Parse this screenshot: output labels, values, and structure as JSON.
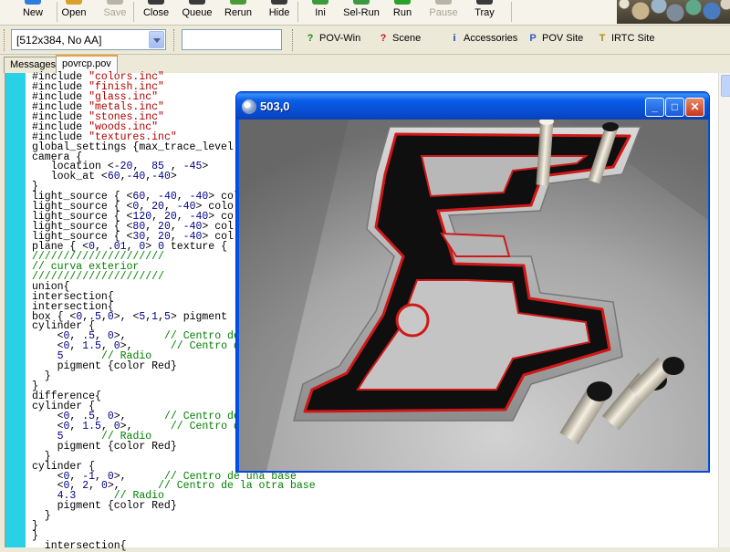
{
  "toolbar": {
    "buttons": [
      {
        "label": "New",
        "icon": "new-icon",
        "color": "#2f7be0"
      },
      {
        "label": "Open",
        "icon": "open-icon",
        "color": "#d9a12b"
      },
      {
        "label": "Save",
        "icon": "save-icon",
        "color": "#b8b5a6",
        "disabled": true
      },
      {
        "label": "Close",
        "icon": "close-file-icon",
        "color": "#3a3a3a"
      },
      {
        "label": "Queue",
        "icon": "queue-icon",
        "color": "#3a3a3a"
      },
      {
        "label": "Rerun",
        "icon": "rerun-icon",
        "color": "#4a9a3a"
      },
      {
        "label": "Hide",
        "icon": "hide-icon",
        "color": "#3a3a3a"
      },
      {
        "label": "Ini",
        "icon": "ini-icon",
        "color": "#3c9a3c"
      },
      {
        "label": "Sel-Run",
        "icon": "sel-run-icon",
        "color": "#3c9a3c"
      },
      {
        "label": "Run",
        "icon": "run-icon",
        "color": "#2aa12a"
      },
      {
        "label": "Pause",
        "icon": "pause-icon",
        "color": "#b8b5a6",
        "disabled": true
      },
      {
        "label": "Tray",
        "icon": "tray-icon",
        "color": "#3a3a3a"
      }
    ]
  },
  "toolbar2": {
    "resolution_value": "[512x384, No AA]",
    "search_value": "",
    "links": [
      {
        "label": "POV-Win",
        "icon": "?",
        "color": "#1e8a1e"
      },
      {
        "label": "Scene",
        "icon": "?",
        "color": "#c01818"
      },
      {
        "label": "Accessories",
        "icon": "i",
        "color": "#1a3fb0"
      },
      {
        "label": "POV Site",
        "icon": "P",
        "color": "#2b5cc8"
      },
      {
        "label": "IRTC Site",
        "icon": "T",
        "color": "#b08a1a"
      }
    ]
  },
  "tabs": [
    {
      "label": "Messages",
      "active": false
    },
    {
      "label": "povrcp.pov",
      "active": true
    }
  ],
  "editor": {
    "lines": [
      [
        [
          "kw",
          "#include "
        ],
        [
          "st",
          "\"colors.inc\""
        ]
      ],
      [
        [
          "kw",
          "#include "
        ],
        [
          "st",
          "\"finish.inc\""
        ]
      ],
      [
        [
          "kw",
          "#include "
        ],
        [
          "st",
          "\"glass.inc\""
        ]
      ],
      [
        [
          "kw",
          "#include "
        ],
        [
          "st",
          "\"metals.inc\""
        ]
      ],
      [
        [
          "kw",
          "#include "
        ],
        [
          "st",
          "\"stones.inc\""
        ]
      ],
      [
        [
          "kw",
          "#include "
        ],
        [
          "st",
          "\"woods.inc\""
        ]
      ],
      [
        [
          "kw",
          "#include "
        ],
        [
          "st",
          "\"textures.inc\""
        ]
      ],
      [
        [
          "kw",
          "global_settings {max_trace_level"
        ]
      ],
      [
        [
          "kw",
          "camera {"
        ]
      ],
      [
        [
          "kw",
          "   location <"
        ],
        [
          "nm",
          "-20"
        ],
        [
          "kw",
          ",  "
        ],
        [
          "nm",
          "85"
        ],
        [
          "kw",
          " , "
        ],
        [
          "nm",
          "-45"
        ],
        [
          "kw",
          ">"
        ]
      ],
      [
        [
          "kw",
          "   look_at <"
        ],
        [
          "nm",
          "60"
        ],
        [
          "kw",
          ","
        ],
        [
          "nm",
          "-40"
        ],
        [
          "kw",
          ","
        ],
        [
          "nm",
          "-40"
        ],
        [
          "kw",
          ">"
        ]
      ],
      [
        [
          "kw",
          "}"
        ]
      ],
      [
        [
          "kw",
          "light_source { <"
        ],
        [
          "nm",
          "60"
        ],
        [
          "kw",
          ", "
        ],
        [
          "nm",
          "-40"
        ],
        [
          "kw",
          ", "
        ],
        [
          "nm",
          "-40"
        ],
        [
          "kw",
          "> col"
        ]
      ],
      [
        [
          "kw",
          "light_source { <"
        ],
        [
          "nm",
          "0"
        ],
        [
          "kw",
          ", "
        ],
        [
          "nm",
          "20"
        ],
        [
          "kw",
          ", "
        ],
        [
          "nm",
          "-40"
        ],
        [
          "kw",
          "> colo"
        ]
      ],
      [
        [
          "kw",
          "light_source { <"
        ],
        [
          "nm",
          "120"
        ],
        [
          "kw",
          ", "
        ],
        [
          "nm",
          "20"
        ],
        [
          "kw",
          ", "
        ],
        [
          "nm",
          "-40"
        ],
        [
          "kw",
          "> co"
        ]
      ],
      [
        [
          "kw",
          "light_source { <"
        ],
        [
          "nm",
          "80"
        ],
        [
          "kw",
          ", "
        ],
        [
          "nm",
          "20"
        ],
        [
          "kw",
          ", "
        ],
        [
          "nm",
          "-40"
        ],
        [
          "kw",
          "> col"
        ]
      ],
      [
        [
          "kw",
          "light_source { <"
        ],
        [
          "nm",
          "30"
        ],
        [
          "kw",
          ", "
        ],
        [
          "nm",
          "20"
        ],
        [
          "kw",
          ", "
        ],
        [
          "nm",
          "-40"
        ],
        [
          "kw",
          "> col"
        ]
      ],
      [
        [
          "kw",
          "plane { <"
        ],
        [
          "nm",
          "0"
        ],
        [
          "kw",
          ", ."
        ],
        [
          "nm",
          "01"
        ],
        [
          "kw",
          ", "
        ],
        [
          "nm",
          "0"
        ],
        [
          "kw",
          "> "
        ],
        [
          "nm",
          "0"
        ],
        [
          "kw",
          " texture {"
        ]
      ],
      [
        [
          "cm",
          "/////////////////////"
        ]
      ],
      [
        [
          "cm",
          "// curva exterior"
        ]
      ],
      [
        [
          "cm",
          "/////////////////////"
        ]
      ],
      [
        [
          "kw",
          "union{"
        ]
      ],
      [
        [
          "kw",
          "intersection{"
        ]
      ],
      [
        [
          "kw",
          "intersection{"
        ]
      ],
      [
        [
          "kw",
          "box { <"
        ],
        [
          "nm",
          "0"
        ],
        [
          "kw",
          ",."
        ],
        [
          "nm",
          "5"
        ],
        [
          "kw",
          ","
        ],
        [
          "nm",
          "0"
        ],
        [
          "kw",
          ">, <"
        ],
        [
          "nm",
          "5"
        ],
        [
          "kw",
          ","
        ],
        [
          "nm",
          "1"
        ],
        [
          "kw",
          ","
        ],
        [
          "nm",
          "5"
        ],
        [
          "kw",
          "> pigment"
        ]
      ],
      [
        [
          "kw",
          "cylinder {"
        ]
      ],
      [
        [
          "kw",
          "    <"
        ],
        [
          "nm",
          "0"
        ],
        [
          "kw",
          ", ."
        ],
        [
          "nm",
          "5"
        ],
        [
          "kw",
          ", "
        ],
        [
          "nm",
          "0"
        ],
        [
          "kw",
          ">,      "
        ],
        [
          "cm",
          "// Centro de"
        ]
      ],
      [
        [
          "kw",
          "    <"
        ],
        [
          "nm",
          "0"
        ],
        [
          "kw",
          ", "
        ],
        [
          "nm",
          "1.5"
        ],
        [
          "kw",
          ", "
        ],
        [
          "nm",
          "0"
        ],
        [
          "kw",
          ">,      "
        ],
        [
          "cm",
          "// Centro d"
        ]
      ],
      [
        [
          "kw",
          "    "
        ],
        [
          "nm",
          "5"
        ],
        [
          "kw",
          "      "
        ],
        [
          "cm",
          "// Radio"
        ]
      ],
      [
        [
          "kw",
          "    pigment {color Red}"
        ]
      ],
      [
        [
          "kw",
          "  }"
        ]
      ],
      [
        [
          "kw",
          "}"
        ]
      ],
      [
        [
          "kw",
          "difference{"
        ]
      ],
      [
        [
          "kw",
          "cylinder {"
        ]
      ],
      [
        [
          "kw",
          "    <"
        ],
        [
          "nm",
          "0"
        ],
        [
          "kw",
          ", ."
        ],
        [
          "nm",
          "5"
        ],
        [
          "kw",
          ", "
        ],
        [
          "nm",
          "0"
        ],
        [
          "kw",
          ">,      "
        ],
        [
          "cm",
          "// Centro de"
        ]
      ],
      [
        [
          "kw",
          "    <"
        ],
        [
          "nm",
          "0"
        ],
        [
          "kw",
          ", "
        ],
        [
          "nm",
          "1.5"
        ],
        [
          "kw",
          ", "
        ],
        [
          "nm",
          "0"
        ],
        [
          "kw",
          ">,      "
        ],
        [
          "cm",
          "// Centro d"
        ]
      ],
      [
        [
          "kw",
          "    "
        ],
        [
          "nm",
          "5"
        ],
        [
          "kw",
          "      "
        ],
        [
          "cm",
          "// Radio"
        ]
      ],
      [
        [
          "kw",
          "    pigment {color Red}"
        ]
      ],
      [
        [
          "kw",
          "  }"
        ]
      ],
      [
        [
          "kw",
          "cylinder {"
        ]
      ],
      [
        [
          "kw",
          "    <"
        ],
        [
          "nm",
          "0"
        ],
        [
          "kw",
          ", "
        ],
        [
          "nm",
          "-1"
        ],
        [
          "kw",
          ", "
        ],
        [
          "nm",
          "0"
        ],
        [
          "kw",
          ">,      "
        ],
        [
          "cm",
          "// Centro de una base"
        ]
      ],
      [
        [
          "kw",
          "    <"
        ],
        [
          "nm",
          "0"
        ],
        [
          "kw",
          ", "
        ],
        [
          "nm",
          "2"
        ],
        [
          "kw",
          ", "
        ],
        [
          "nm",
          "0"
        ],
        [
          "kw",
          ">,      "
        ],
        [
          "cm",
          "// Centro de la otra base"
        ]
      ],
      [
        [
          "kw",
          "    "
        ],
        [
          "nm",
          "4.3"
        ],
        [
          "kw",
          "      "
        ],
        [
          "cm",
          "// Radio"
        ]
      ],
      [
        [
          "kw",
          "    pigment {color Red}"
        ]
      ],
      [
        [
          "kw",
          "  }"
        ]
      ],
      [
        [
          "kw",
          "}"
        ]
      ],
      [
        [
          "kw",
          "}"
        ]
      ],
      [
        [
          "kw",
          "  intersection{"
        ]
      ]
    ]
  },
  "render_window": {
    "title": "503,0",
    "minimize_label": "_",
    "maximize_label": "□",
    "close_label": "✕"
  }
}
